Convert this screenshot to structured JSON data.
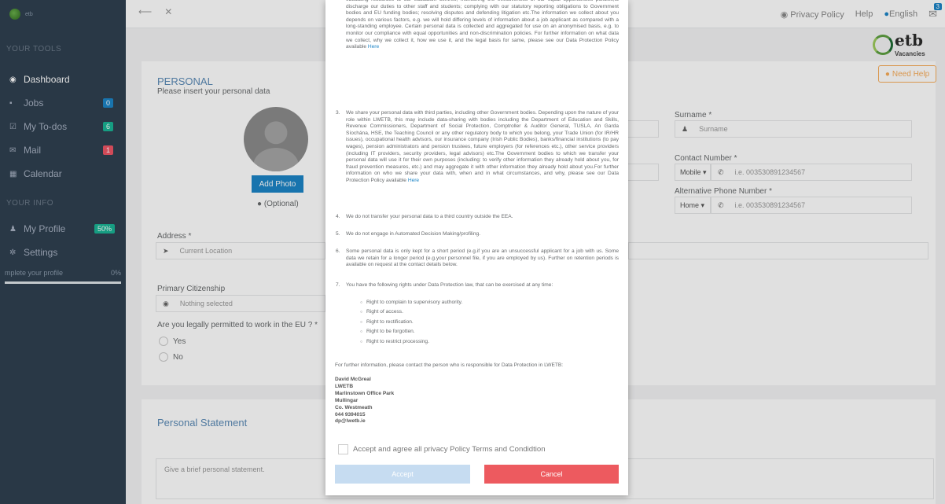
{
  "sidebar": {
    "logo_text": "etb",
    "section_tools": "YOUR TOOLS",
    "items": [
      {
        "label": "Dashboard",
        "icon": "dashboard-icon",
        "glyph": "◉"
      },
      {
        "label": "Jobs",
        "icon": "briefcase-icon",
        "glyph": "▪",
        "badge": "0"
      },
      {
        "label": "My To-dos",
        "icon": "checkbox-icon",
        "glyph": "☑",
        "badge": "6"
      },
      {
        "label": "Mail",
        "icon": "envelope-icon",
        "glyph": "✉",
        "badge": "1"
      },
      {
        "label": "Calendar",
        "icon": "calendar-icon",
        "glyph": "▦"
      }
    ],
    "section_info": "YOUR INFO",
    "profile": {
      "label": "My Profile",
      "icon": "user-icon",
      "glyph": "♟",
      "badge": "50%"
    },
    "settings": {
      "label": "Settings",
      "icon": "gear-icon",
      "glyph": "✲"
    },
    "complete_label": "mplete your profile",
    "complete_value": "0%"
  },
  "topbar": {
    "back_glyph": "⟵",
    "close_glyph": "✕",
    "privacy": "Privacy Policy",
    "help": "Help",
    "language": "English",
    "mail_badge": "3"
  },
  "brand": {
    "logo_main": "etb",
    "logo_sub": "Vacancies"
  },
  "need_help": "Need Help",
  "personal": {
    "title": "PERSONAL",
    "subtitle": "Please insert your personal data",
    "add_photo": "Add Photo",
    "optional": "(Optional)",
    "surname_label": "Surname *",
    "surname_placeholder": "Surname",
    "contact_label": "Contact Number *",
    "contact_type": "Mobile",
    "contact_placeholder": "i.e. 003530891234567",
    "alt_label": "Alternative Phone Number *",
    "alt_type": "Home",
    "alt_placeholder": "i.e. 003530891234567",
    "address_label": "Address *",
    "address_placeholder": "Current Location",
    "citizenship_label": "Primary Citizenship",
    "citizenship_value": "Nothing selected",
    "eu_question": "Are you legally permitted to work in the EU ? *",
    "eu_yes": "Yes",
    "eu_no": "No"
  },
  "statement": {
    "title": "Personal Statement",
    "placeholder": "Give a brief personal statement."
  },
  "modal": {
    "p_top": "educating resources to our education centres; monitoring the effectiveness of our equal opportunities policies;to discharge our duties to other staff and students; complying with our statutory reporting obligations to Government bodies and EU funding bodies; resolving disputes and defending litigation etc.The information we collect about you depends on various factors, e.g. we will hold differing levels of information about a job applicant as compared with a long-standing employee. Certain personal data is collected and aggregated for use on an anonymised basis, e.g. to monitor our compliance with equal opportunities and non-discrimination policies. For further information on what data we collect, why we collect it, how we use it, and the legal basis for same, please see our Data Protection Policy available",
    "here": "Here",
    "n3": "3.",
    "p3": "We share your personal data with third parties, including other Government bodies. Depending upon the nature of your role within LWETB, this may include data-sharing with bodies including the Department of Education and Skills, Revenue Commissioners, Department of Social Protection, Comptroller & Auditor General, TUSLA, An Garda Síochána, HSE, the Teaching Council or any other regulatory body to which you belong, your Trade Union (for IR/HR issues), occupational health advisors, our insurance company (Irish Public Bodies), banks/financial institutions (to pay wages), pension administrators and pension trustees, future employers (for references etc.), other service providers (including IT providers, security providers, legal advisors) etc.The Government bodies to which we transfer your personal data will use it for their own purposes (including: to verify other information they already hold about you, for fraud prevention measures, etc.) and may aggregate it with other information they already hold about you.For further information on who we share your data with, when and in what circumstances, and why, please see our Data Protection Policy available",
    "n4": "4.",
    "p4": "We do not transfer your personal data to a third country outside the EEA.",
    "n5": "5.",
    "p5": "We do not engage in Automated Decision Making/profiling.",
    "n6": "6.",
    "p6": "Some personal data is only kept for a short period (e.g.if you are an unsuccessful applicant for a job with us. Some data we retain for a longer period (e.g.your personnel file, if you are employed by us). Further on retention periods is available on request at the contact details below.",
    "n7": "7.",
    "p7": "You have the following rights under Data Protection law, that can be exercised at any time:",
    "rights": [
      "Right to complain to supervisory authority.",
      "Right of access.",
      "Right to rectification.",
      "Right to be forgotten.",
      "Right to restrict processing."
    ],
    "contact_intro": "For further information, please contact the person who is responsible for Data Protection in LWETB:",
    "contact": [
      "David McGreal",
      "LWETB",
      "Marlinstown Office Park",
      "Mullingar",
      "Co. Westmeath",
      "044 9394015",
      "dp@lwetb.ie"
    ],
    "agree": "Accept and agree all privacy Policy Terms and Condidtion",
    "accept": "Accept",
    "cancel": "Cancel"
  }
}
